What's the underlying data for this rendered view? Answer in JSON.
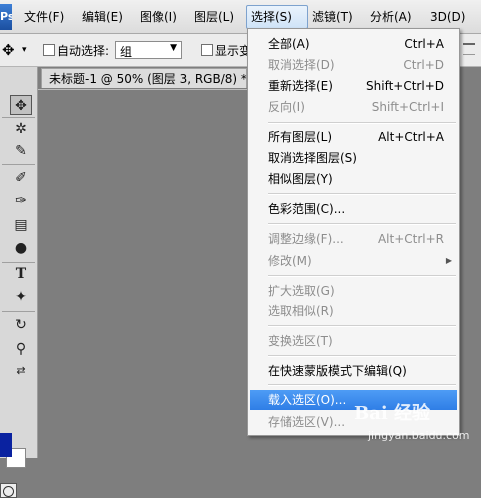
{
  "menubar": {
    "logo": "Ps",
    "items": [
      "文件(F)",
      "编辑(E)",
      "图像(I)",
      "图层(L)",
      "选择(S)",
      "滤镜(T)",
      "分析(A)",
      "3D(D)"
    ],
    "active_index": 4
  },
  "options": {
    "move_tool_glyph": "✥",
    "auto_select_label": "自动选择:",
    "auto_select_value": "组",
    "show_transform_label": "显示变"
  },
  "document": {
    "tab_title": "未标题-1 @ 50% (图层 3, RGB/8) *",
    "close_glyph": "×"
  },
  "tools": {
    "foreground_color": "#0a22a0",
    "background_color": "#ffffff",
    "icons": [
      "move-tool",
      "magic-wand-tool",
      "eyedropper-tool",
      "brush-tool",
      "history-brush-tool",
      "gradient-tool",
      "dodge-tool",
      "type-tool",
      "custom-shape-tool",
      "3d-rotate-tool",
      "zoom-tool",
      "swap-colors"
    ]
  },
  "select_menu": {
    "items": [
      {
        "label": "全部(A)",
        "shortcut": "Ctrl+A",
        "disabled": false
      },
      {
        "label": "取消选择(D)",
        "shortcut": "Ctrl+D",
        "disabled": true
      },
      {
        "label": "重新选择(E)",
        "shortcut": "Shift+Ctrl+D",
        "disabled": false
      },
      {
        "label": "反向(I)",
        "shortcut": "Shift+Ctrl+I",
        "disabled": true
      },
      {
        "label": "所有图层(L)",
        "shortcut": "Alt+Ctrl+A",
        "disabled": false
      },
      {
        "label": "取消选择图层(S)",
        "shortcut": "",
        "disabled": false
      },
      {
        "label": "相似图层(Y)",
        "shortcut": "",
        "disabled": false
      },
      {
        "label": "色彩范围(C)...",
        "shortcut": "",
        "disabled": false
      },
      {
        "label": "调整边缘(F)...",
        "shortcut": "Alt+Ctrl+R",
        "disabled": true
      },
      {
        "label": "修改(M)",
        "shortcut": "",
        "disabled": true,
        "submenu": true
      },
      {
        "label": "扩大选取(G)",
        "shortcut": "",
        "disabled": true
      },
      {
        "label": "选取相似(R)",
        "shortcut": "",
        "disabled": true
      },
      {
        "label": "变换选区(T)",
        "shortcut": "",
        "disabled": true
      },
      {
        "label": "在快速蒙版模式下编辑(Q)",
        "shortcut": "",
        "disabled": false
      },
      {
        "label": "载入选区(O)...",
        "shortcut": "",
        "disabled": false,
        "highlighted": true
      },
      {
        "label": "存储选区(V)...",
        "shortcut": "",
        "disabled": true
      }
    ]
  },
  "watermark": {
    "brand": "Bai 经验",
    "url": "jingyan.baidu.com"
  }
}
